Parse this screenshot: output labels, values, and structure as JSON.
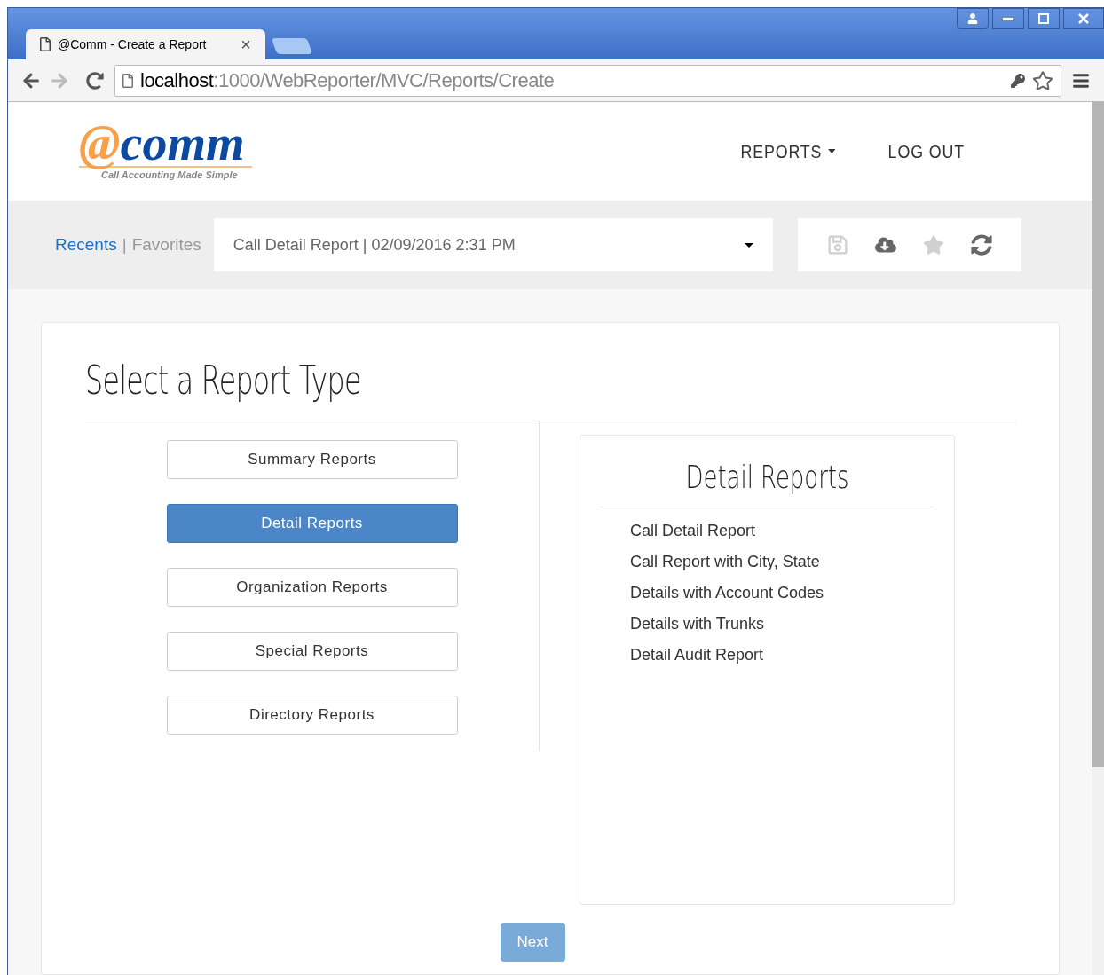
{
  "browser": {
    "tab_title": "@Comm - Create a Report",
    "tab_close": "×",
    "url_host": "localhost",
    "url_path": ":1000/WebReporter/MVC/Reports/Create"
  },
  "logo": {
    "at": "@",
    "word": "comm",
    "tagline": "Call Accounting Made Simple"
  },
  "nav": [
    {
      "label": "REPORTS",
      "kind": "dropdown"
    },
    {
      "label": "LOG OUT",
      "kind": "link"
    }
  ],
  "history_tabs": [
    {
      "label": "Recents",
      "selected": true
    },
    {
      "label": "Favorites",
      "selected": false
    }
  ],
  "history_separator": "|",
  "recent_select": {
    "value": "Call Detail Report | 02/09/2016 2:31 PM"
  },
  "actions": [
    {
      "kind": "save",
      "disabled": true
    },
    {
      "kind": "download",
      "disabled": false
    },
    {
      "kind": "favorite",
      "disabled": true
    },
    {
      "kind": "refresh",
      "disabled": false
    }
  ],
  "heading": "Select a Report Type",
  "categories": [
    {
      "label": "Summary Reports",
      "selected": false
    },
    {
      "label": "Detail Reports",
      "selected": true
    },
    {
      "label": "Organization Reports",
      "selected": false
    },
    {
      "label": "Special Reports",
      "selected": false
    },
    {
      "label": "Directory Reports",
      "selected": false
    }
  ],
  "panel": {
    "title": "Detail Reports",
    "items": [
      "Call Detail Report",
      "Call Report with City, State",
      "Details with Account Codes",
      "Details with Trunks",
      "Detail Audit Report"
    ]
  },
  "next_button": {
    "label": "Next",
    "disabled": true
  }
}
